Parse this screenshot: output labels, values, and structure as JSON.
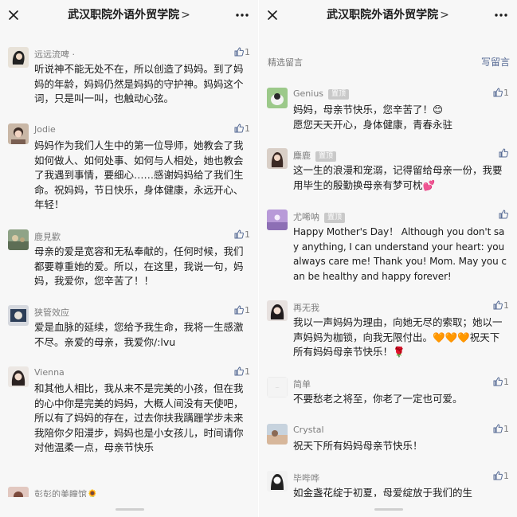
{
  "colors": {
    "background": "#f7f7f7",
    "link": "#576b95",
    "nickname": "#7d7d7d",
    "badge": "#c9c9c9"
  },
  "left": {
    "title": "武汉职院外语外贸学院",
    "chevron": ">",
    "comments": [
      {
        "nickname": "远远流啤",
        "nickname_suffix": "·",
        "likes": "1",
        "text": "听说神不能无处不在，所以创造了妈妈。到了妈妈的年龄，妈妈仍然是妈妈的守护神。妈妈这个词，只是叫一叫，也触动心弦。"
      },
      {
        "nickname": "Jodie",
        "likes": "1",
        "text": "妈妈作为我们人生中的第一位导师，她教会了我如何做人、如何处事、如何与人相处，她也教会了我遇到事情，要细心……感谢妈妈给了我们生命。祝妈妈，节日快乐，身体健康，永远开心、年轻！"
      },
      {
        "nickname": "鹿見歡",
        "likes": "1",
        "text": "母亲的爱是宽容和无私奉献的，任何时候，我们都要尊重她的爱。所以，在这里，我说一句，妈妈，我爱你，您辛苦了！！"
      },
      {
        "nickname": "狭管效应",
        "likes": "1",
        "text": "爱是血脉的延续，您给予我生命，我将一生感激不尽。亲爱的母亲，我爱你/:lvu"
      },
      {
        "nickname": "Vienna",
        "likes": "1",
        "text": "和其他人相比，我从来不是完美的小孩，但在我的心中你是完美的妈妈，大概人间没有天使吧，所以有了妈妈的存在，过去你扶我蹒跚学步未来我陪你夕阳漫步，妈妈也是小女孩儿，时间请你对他温柔一点，母亲节快乐"
      },
      {
        "nickname": "彭彭的美瞳馆",
        "nickname_suffix": "🌻",
        "likes": "",
        "text": ""
      }
    ]
  },
  "right": {
    "title": "武汉职院外语外贸学院",
    "chevron": ">",
    "section_label": "精选留言",
    "write_label": "写留言",
    "comments": [
      {
        "nickname": "Genius",
        "badge": "置顶",
        "likes": "1",
        "text": "妈妈，母亲节快乐，您辛苦了！😊\n愿您天天开心，身体健康，青春永驻"
      },
      {
        "nickname": "麋鹿",
        "badge": "置顶",
        "likes": "",
        "text": "这一生的浪漫和宠溺，记得留给母亲一份，我要用毕生的殷勤换母亲有梦可枕💕"
      },
      {
        "nickname": "尤唏呐",
        "badge": "置顶",
        "likes": "",
        "text": "Happy Mother's Day！ Although you don't say anything, I can understand your heart: you always care me! Thank you! Mom. May you can be healthy and happy forever!"
      },
      {
        "nickname": "再无我",
        "likes": "1",
        "text": "我以一声妈妈为理由，向她无尽的索取；她以一声妈妈为枷锁，向我无限付出。🧡🧡🧡祝天下所有妈妈母亲节快乐！🌹"
      },
      {
        "nickname": "简单",
        "likes": "1",
        "text": "不要愁老之将至，你老了一定也可爱。"
      },
      {
        "nickname": "Crystal",
        "likes": "1",
        "text": "祝天下所有妈妈母亲节快乐！"
      },
      {
        "nickname": "毕哔哗",
        "likes": "1",
        "text": "如金盏花绽于初夏，母爱绽放于我们的生"
      }
    ]
  }
}
